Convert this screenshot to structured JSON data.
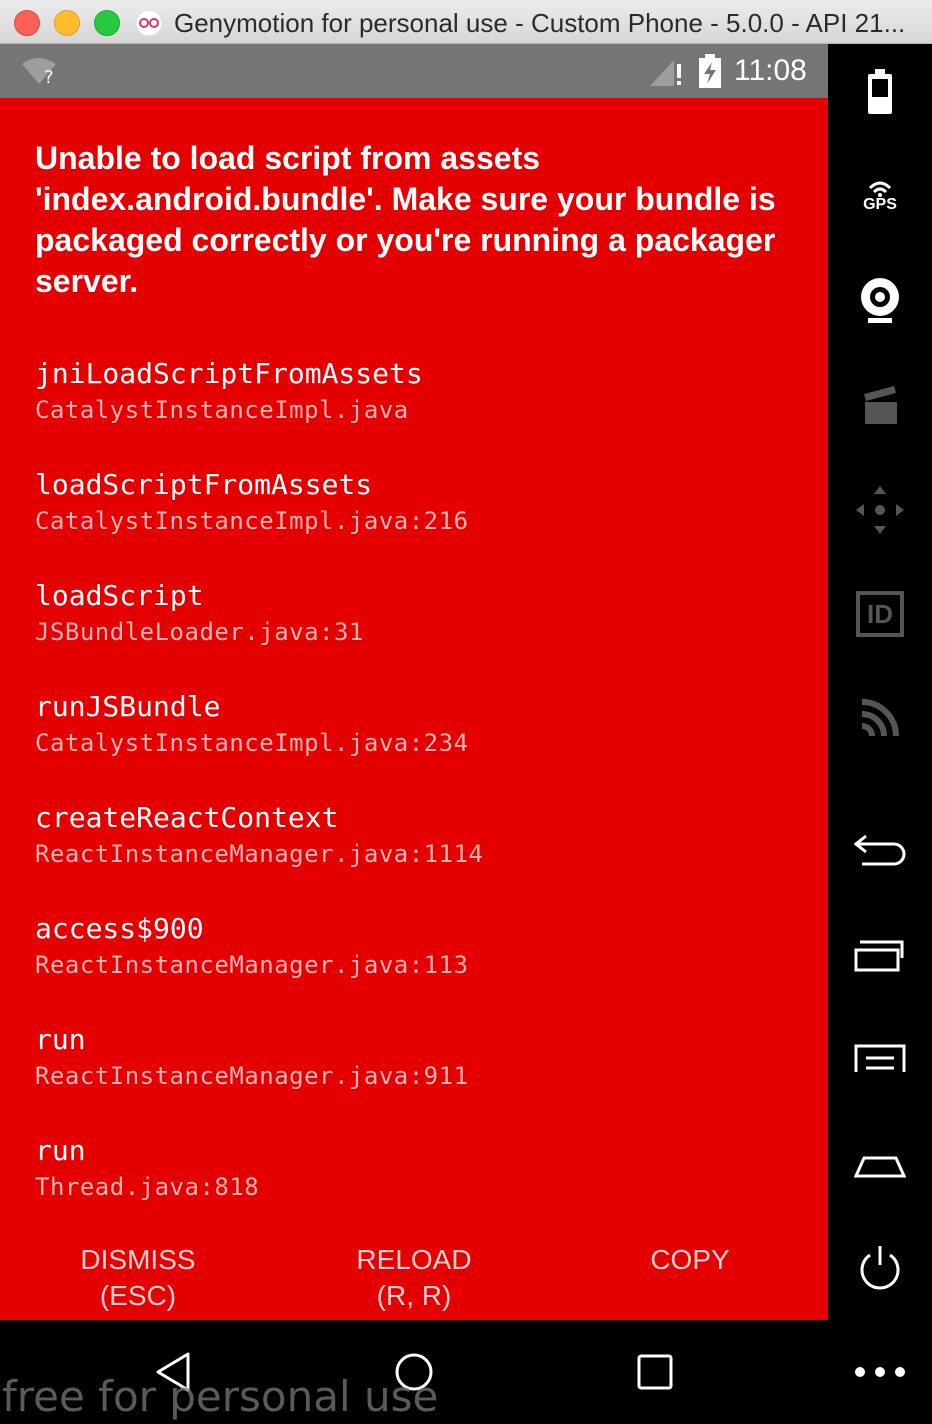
{
  "window": {
    "title": "Genymotion for personal use - Custom Phone - 5.0.0 - API 21..."
  },
  "status_bar": {
    "time": "11:08"
  },
  "error": {
    "message": "Unable to load script from assets 'index.android.bundle'. Make sure your bundle is packaged correctly or you're running a packager server.",
    "stack": [
      {
        "method": "jniLoadScriptFromAssets",
        "file": "CatalystInstanceImpl.java"
      },
      {
        "method": "loadScriptFromAssets",
        "file": "CatalystInstanceImpl.java:216"
      },
      {
        "method": "loadScript",
        "file": "JSBundleLoader.java:31"
      },
      {
        "method": "runJSBundle",
        "file": "CatalystInstanceImpl.java:234"
      },
      {
        "method": "createReactContext",
        "file": "ReactInstanceManager.java:1114"
      },
      {
        "method": "access$900",
        "file": "ReactInstanceManager.java:113"
      },
      {
        "method": "run",
        "file": "ReactInstanceManager.java:911"
      },
      {
        "method": "run",
        "file": "Thread.java:818"
      }
    ]
  },
  "buttons": {
    "dismiss_line1": "DISMISS",
    "dismiss_line2": "(ESC)",
    "reload_line1": "RELOAD",
    "reload_line2": "(R, R)",
    "copy": "COPY"
  },
  "sidebar": {
    "gps_label": "GPS",
    "id_label": "ID"
  },
  "watermark": "free for personal use",
  "colors": {
    "redbox": "#e40000",
    "status_bar": "#757575"
  }
}
